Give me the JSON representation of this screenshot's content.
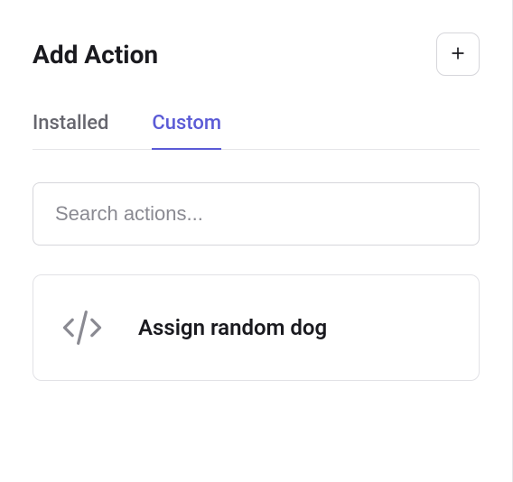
{
  "header": {
    "title": "Add Action"
  },
  "tabs": [
    {
      "label": "Installed",
      "active": false
    },
    {
      "label": "Custom",
      "active": true
    }
  ],
  "search": {
    "placeholder": "Search actions...",
    "value": ""
  },
  "actions": [
    {
      "label": "Assign random dog",
      "icon": "code-icon"
    }
  ]
}
